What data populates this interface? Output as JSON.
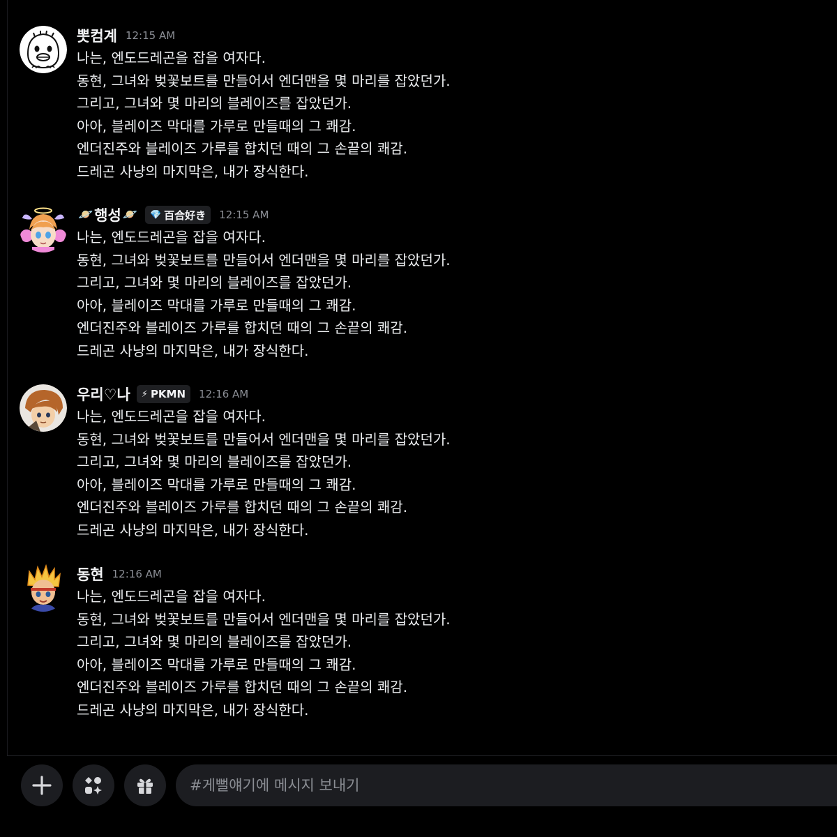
{
  "messages": [
    {
      "username": "뽓컴계",
      "timestamp": "12:15 AM",
      "avatar_icon": "egg-face-avatar-icon",
      "lines": [
        "나는, 엔도드레곤을 잡을 여자다.",
        "동현, 그녀와 벚꽃보트를 만들어서 엔더맨을 몇 마리를 잡았던가.",
        "그리고, 그녀와 몇 마리의 블레이즈를 잡았던가.",
        "아아, 블레이즈 막대를 가루로 만들때의 그 쾌감.",
        "엔더진주와 블레이즈 가루를 합치던 때의 그 손끝의 쾌감.",
        "드레곤 사냥의 마지막은, 내가 장식한다."
      ]
    },
    {
      "username": "행성",
      "username_prefix": "🪐",
      "username_suffix": "🪐",
      "tag": "百合好き",
      "tag_icon": "💎",
      "timestamp": "12:15 AM",
      "avatar_icon": "angel-anime-avatar-icon",
      "lines": [
        "나는, 엔도드레곤을 잡을 여자다.",
        "동현, 그녀와 벚꽃보트를 만들어서 엔더맨을 몇 마리를 잡았던가.",
        "그리고, 그녀와 몇 마리의 블레이즈를 잡았던가.",
        "아아, 블레이즈 막대를 가루로 만들때의 그 쾌감.",
        "엔더진주와 블레이즈 가루를 합치던 때의 그 손끝의 쾌감.",
        "드레곤 사냥의 마지막은, 내가 장식한다."
      ]
    },
    {
      "username": "우리♡나",
      "tag": "PKMN",
      "tag_icon": "⚡",
      "timestamp": "12:16 AM",
      "avatar_icon": "brown-hair-avatar-icon",
      "lines": [
        "나는, 엔도드레곤을 잡을 여자다.",
        "동현, 그녀와 벚꽃보트를 만들어서 엔더맨을 몇 마리를 잡았던가.",
        "그리고, 그녀와 몇 마리의 블레이즈를 잡았던가.",
        "아아, 블레이즈 막대를 가루로 만들때의 그 쾌감.",
        "엔더진주와 블레이즈 가루를 합치던 때의 그 손끝의 쾌감.",
        "드레곤 사냥의 마지막은, 내가 장식한다."
      ]
    },
    {
      "username": "동현",
      "timestamp": "12:16 AM",
      "avatar_icon": "spiky-hair-avatar-icon",
      "lines": [
        "나는, 엔도드레곤을 잡을 여자다.",
        "동현, 그녀와 벚꽃보트를 만들어서 엔더맨을 몇 마리를 잡았던가.",
        "그리고, 그녀와 몇 마리의 블레이즈를 잡았던가.",
        "아아, 블레이즈 막대를 가루로 만들때의 그 쾌감.",
        "엔더진주와 블레이즈 가루를 합치던 때의 그 손끝의 쾌감.",
        "드레곤 사냥의 마지막은, 내가 장식한다."
      ]
    }
  ],
  "composer": {
    "placeholder": "#게뻘얘기에 메시지 보내기",
    "value": "",
    "buttons": [
      "plus-icon",
      "apps-icon",
      "gift-icon"
    ]
  },
  "colors": {
    "background": "#000000",
    "surface": "#1c1d21",
    "text": "#f2f3f5",
    "muted": "#8c8f96"
  }
}
